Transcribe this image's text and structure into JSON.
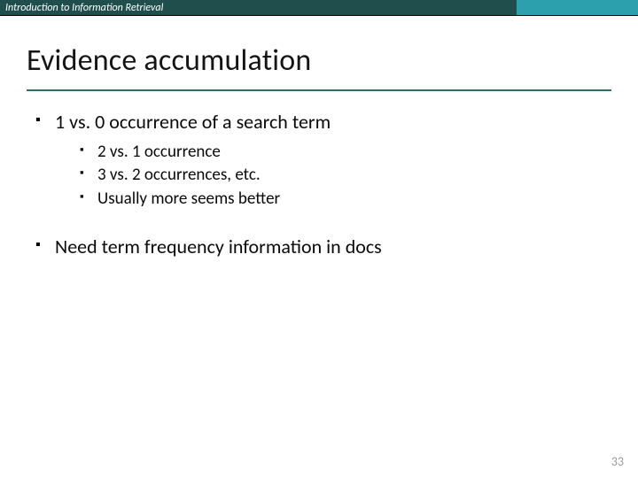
{
  "header": {
    "course": "Introduction to Information Retrieval"
  },
  "slide": {
    "title": "Evidence accumulation",
    "number": "33"
  },
  "bullets": {
    "b1": "1 vs. 0 occurrence of a search term",
    "b1_sub": {
      "s1": "2 vs. 1 occurrence",
      "s2": "3 vs. 2 occurrences, etc.",
      "s3": "Usually more seems better"
    },
    "b2": "Need term frequency information in docs"
  }
}
